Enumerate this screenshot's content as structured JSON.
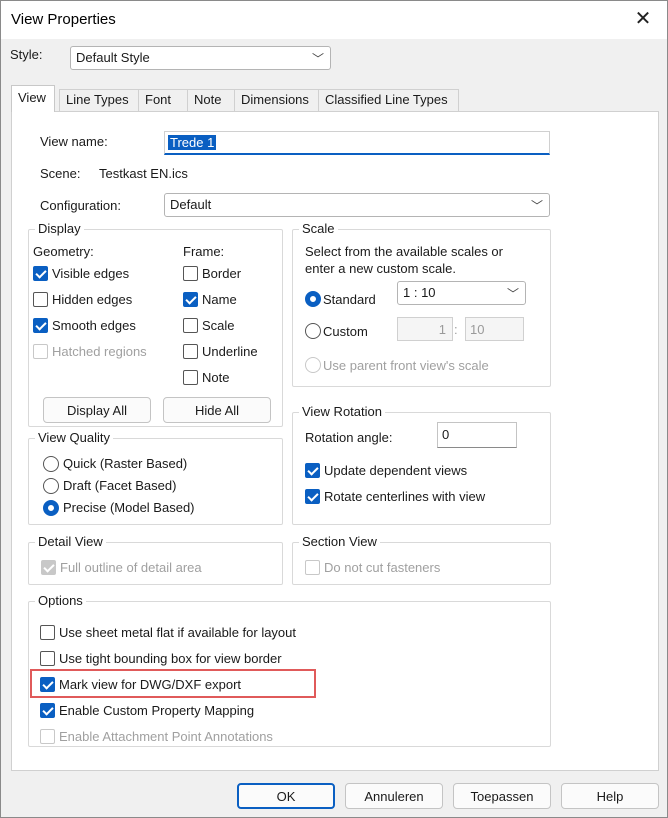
{
  "window": {
    "title": "View Properties",
    "close": "✕"
  },
  "style": {
    "label": "Style:",
    "value": "Default Style"
  },
  "tabs": [
    {
      "label": "View"
    },
    {
      "label": "Line Types"
    },
    {
      "label": "Font"
    },
    {
      "label": "Note"
    },
    {
      "label": "Dimensions"
    },
    {
      "label": "Classified Line Types"
    }
  ],
  "view": {
    "name_label": "View name:",
    "name_value": "Trede 1",
    "scene_label": "Scene:",
    "scene_value": "Testkast EN.ics",
    "config_label": "Configuration:",
    "config_value": "Default"
  },
  "display": {
    "title": "Display",
    "geometry_label": "Geometry:",
    "frame_label": "Frame:",
    "geometry": [
      {
        "label": "Visible edges",
        "checked": true
      },
      {
        "label": "Hidden edges",
        "checked": false
      },
      {
        "label": "Smooth edges",
        "checked": true
      },
      {
        "label": "Hatched regions",
        "checked": false,
        "disabled": true
      }
    ],
    "frame": [
      {
        "label": "Border",
        "checked": false
      },
      {
        "label": "Name",
        "checked": true
      },
      {
        "label": "Scale",
        "checked": false
      },
      {
        "label": "Underline",
        "checked": false
      },
      {
        "label": "Note",
        "checked": false
      }
    ],
    "display_all": "Display All",
    "hide_all": "Hide All"
  },
  "scale": {
    "title": "Scale",
    "desc1": "Select from the available scales or",
    "desc2": "enter a new custom scale.",
    "standard_label": "Standard",
    "standard_value": "1 : 10",
    "custom_label": "Custom",
    "custom_num": "1",
    "custom_sep": ":",
    "custom_den": "10",
    "parent_label": "Use parent front view's scale"
  },
  "quality": {
    "title": "View Quality",
    "options": [
      {
        "label": "Quick (Raster Based)",
        "selected": false
      },
      {
        "label": "Draft (Facet Based)",
        "selected": false
      },
      {
        "label": "Precise (Model Based)",
        "selected": true
      }
    ]
  },
  "rotation": {
    "title": "View Rotation",
    "angle_label": "Rotation angle:",
    "angle_value": "0",
    "update_label": "Update dependent views",
    "rotate_label": "Rotate centerlines with view"
  },
  "detail": {
    "title": "Detail View",
    "outline_label": "Full outline of detail area"
  },
  "section": {
    "title": "Section View",
    "fasteners_label": "Do not cut fasteners"
  },
  "options": {
    "title": "Options",
    "items": [
      {
        "label": "Use sheet metal flat if available for layout",
        "checked": false
      },
      {
        "label": "Use tight bounding box for view border",
        "checked": false
      },
      {
        "label": "Mark view for DWG/DXF export",
        "checked": true
      },
      {
        "label": "Enable Custom Property Mapping",
        "checked": true
      },
      {
        "label": "Enable Attachment Point Annotations",
        "checked": false,
        "disabled": true
      }
    ]
  },
  "buttons": {
    "ok": "OK",
    "cancel": "Annuleren",
    "apply": "Toepassen",
    "help": "Help"
  },
  "colors": {
    "accent": "#0a5fc2",
    "highlight": "#e05a5a"
  }
}
